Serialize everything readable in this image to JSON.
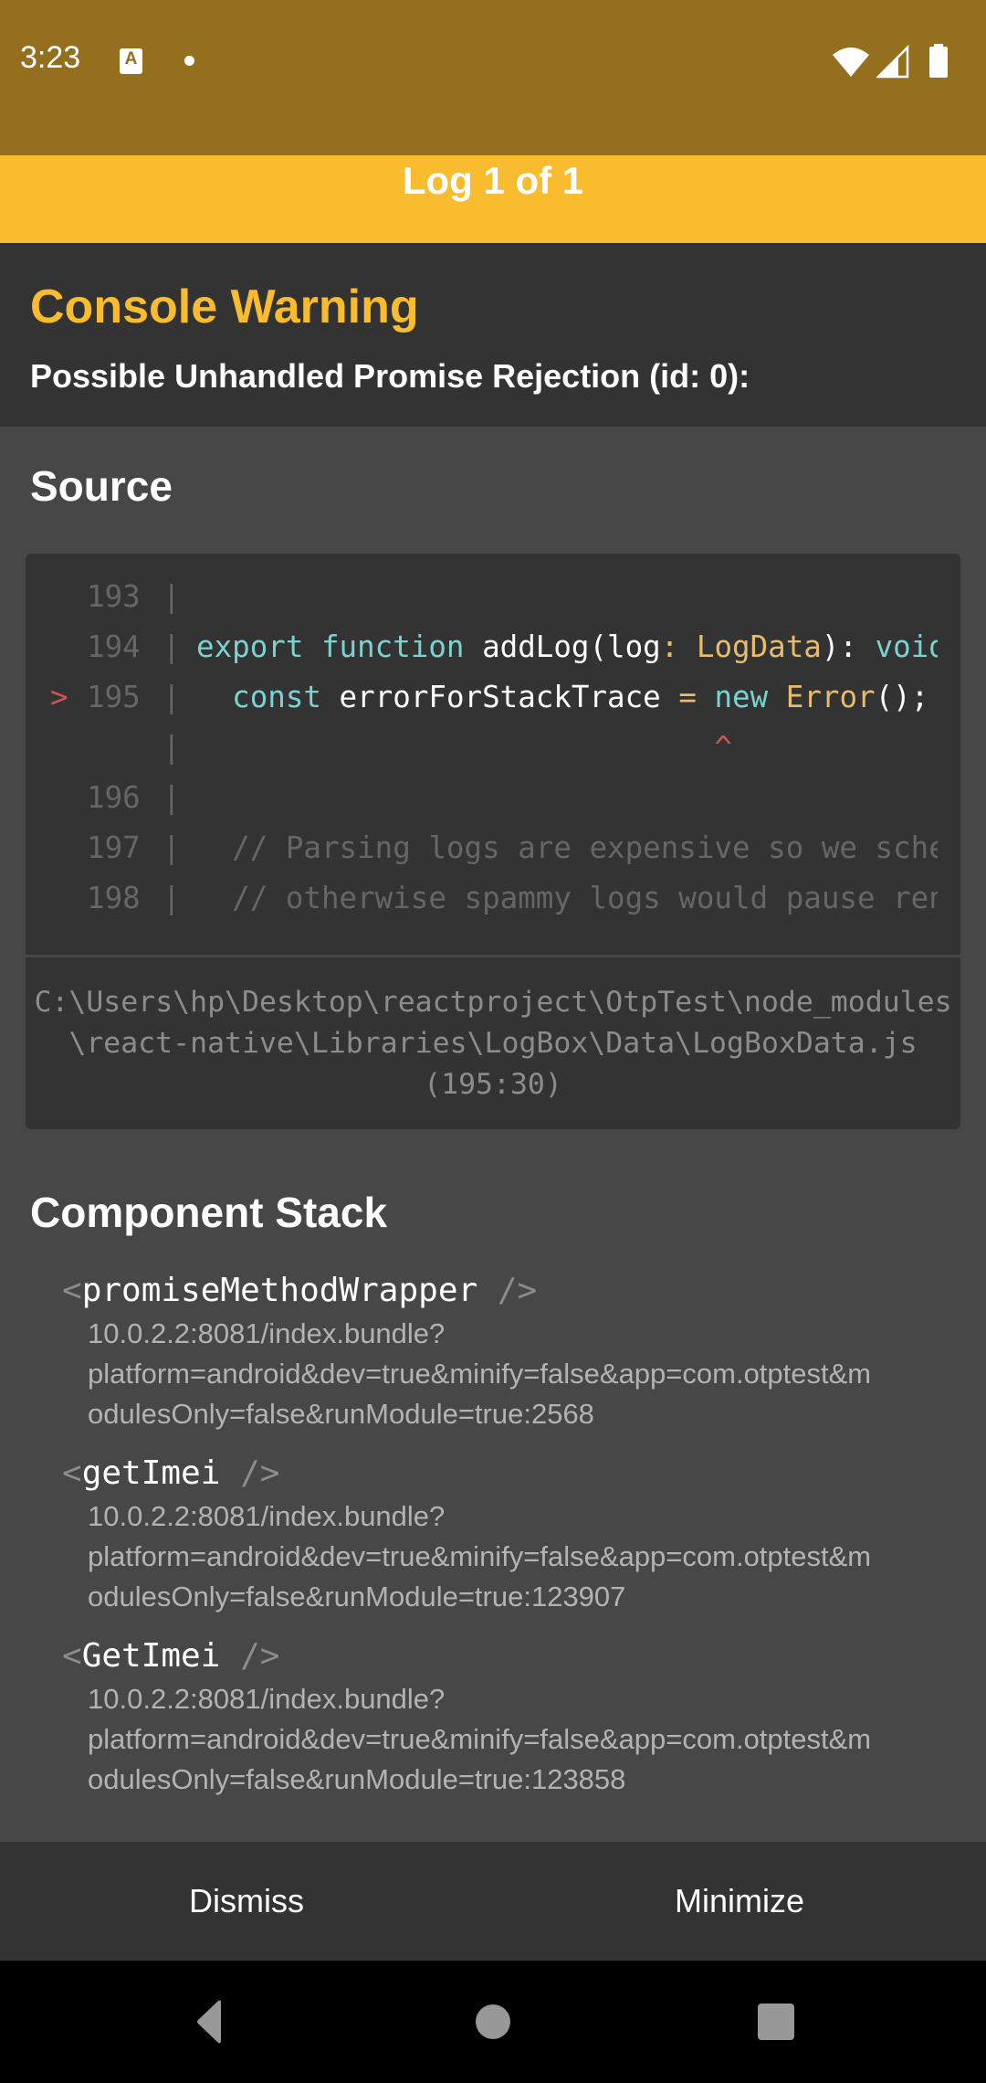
{
  "status_bar": {
    "time": "3:23",
    "icons": [
      "accessibility-a-icon",
      "notification-dot-icon",
      "wifi-icon",
      "cell-signal-icon",
      "battery-icon"
    ]
  },
  "header": {
    "title": "Log 1 of 1"
  },
  "log": {
    "level": "Console Warning",
    "message": "Possible Unhandled Promise Rejection (id: 0):"
  },
  "source": {
    "heading": "Source",
    "lines": [
      {
        "marker": "",
        "number": "193",
        "pipe": "|",
        "tokens": []
      },
      {
        "marker": "",
        "number": "194",
        "pipe": "|",
        "tokens": [
          {
            "t": "export function ",
            "c": "kw"
          },
          {
            "t": "addLog(log",
            "c": "plain"
          },
          {
            "t": ": ",
            "c": "punct"
          },
          {
            "t": "LogData",
            "c": "type"
          },
          {
            "t": "): ",
            "c": "plain"
          },
          {
            "t": "void",
            "c": "kw"
          }
        ]
      },
      {
        "marker": ">",
        "number": "195",
        "pipe": "|",
        "tokens": [
          {
            "t": "  const ",
            "c": "kw"
          },
          {
            "t": "errorForStackTrace ",
            "c": "plain"
          },
          {
            "t": "= ",
            "c": "punct"
          },
          {
            "t": "new ",
            "c": "kw"
          },
          {
            "t": "Error",
            "c": "type"
          },
          {
            "t": "();",
            "c": "plain"
          }
        ]
      },
      {
        "marker": "",
        "number": "",
        "pipe": "|",
        "tokens": [
          {
            "t": "                             ^",
            "c": "caret"
          }
        ]
      },
      {
        "marker": "",
        "number": "196",
        "pipe": "|",
        "tokens": []
      },
      {
        "marker": "",
        "number": "197",
        "pipe": "|",
        "tokens": [
          {
            "t": "  // Parsing logs are expensive so we schedule",
            "c": "comment"
          }
        ]
      },
      {
        "marker": "",
        "number": "198",
        "pipe": "|",
        "tokens": [
          {
            "t": "  // otherwise spammy logs would pause rendering",
            "c": "comment"
          }
        ]
      }
    ],
    "file_path": "C:\\Users\\hp\\Desktop\\reactproject\\OtpTest\\node_modules\\react-native\\Libraries\\LogBox\\Data\\LogBoxData.js",
    "position": "(195:30)"
  },
  "component_stack": {
    "heading": "Component Stack",
    "items": [
      {
        "open": "<",
        "name": "promiseMethodWrapper",
        "close": " />",
        "location_lines": [
          "10.0.2.2:8081/index.bundle?",
          "platform=android&dev=true&minify=false&app=com.otptest&m",
          "odulesOnly=false&runModule=true:2568"
        ]
      },
      {
        "open": "<",
        "name": "getImei",
        "close": " />",
        "location_lines": [
          "10.0.2.2:8081/index.bundle?",
          "platform=android&dev=true&minify=false&app=com.otptest&m",
          "odulesOnly=false&runModule=true:123907"
        ]
      },
      {
        "open": "<",
        "name": "GetImei",
        "close": " />",
        "location_lines": [
          "10.0.2.2:8081/index.bundle?",
          "platform=android&dev=true&minify=false&app=com.otptest&m",
          "odulesOnly=false&runModule=true:123858"
        ]
      }
    ]
  },
  "footer": {
    "dismiss_label": "Dismiss",
    "minimize_label": "Minimize"
  },
  "nav_bar": {
    "buttons": [
      "back",
      "home",
      "recents"
    ]
  },
  "colors": {
    "status_bar": "#946f1e",
    "warning_accent": "#f9bc2f",
    "dark_panel": "#333333",
    "body_bg": "#474747",
    "keyword": "#7ad3cf",
    "type": "#e6bc6e",
    "error_marker": "#cc5454"
  }
}
